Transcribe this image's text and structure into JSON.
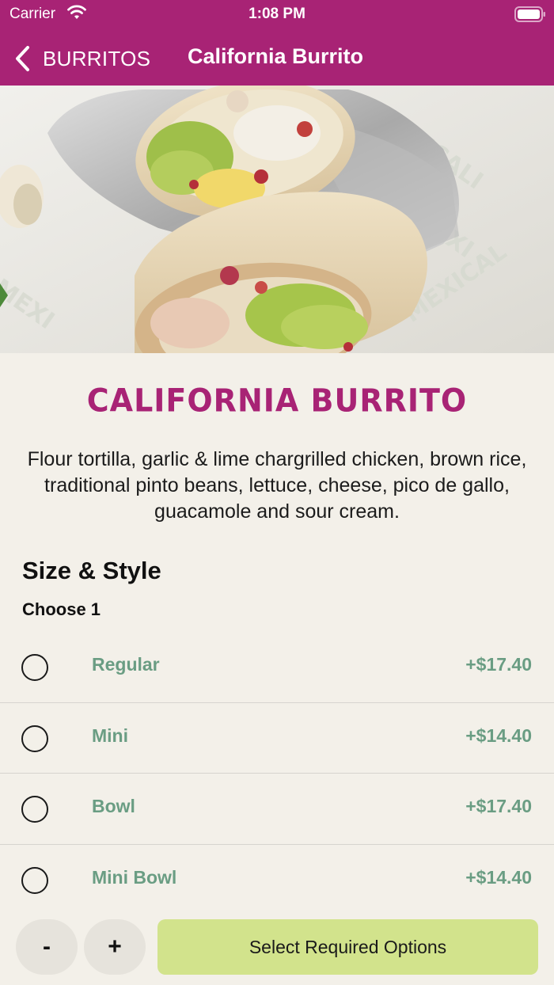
{
  "status_bar": {
    "carrier": "Carrier",
    "time": "1:08 PM"
  },
  "nav": {
    "back_label": "BURRITOS",
    "title": "California Burrito"
  },
  "product": {
    "name": "CALIFORNIA BURRITO",
    "description": "Flour tortilla, garlic & lime chargrilled chicken, brown rice, traditional pinto beans, lettuce, cheese, pico de gallo, guacamole and sour cream."
  },
  "options_group": {
    "title": "Size & Style",
    "subtitle": "Choose 1",
    "items": [
      {
        "label": "Regular",
        "price": "+$17.40"
      },
      {
        "label": "Mini",
        "price": "+$14.40"
      },
      {
        "label": "Bowl",
        "price": "+$17.40"
      },
      {
        "label": "Mini Bowl",
        "price": "+$14.40"
      }
    ]
  },
  "bottom": {
    "minus_label": "-",
    "plus_label": "+",
    "cta_label": "Select Required Options"
  },
  "colors": {
    "brand": "#a82375",
    "option_text": "#6a9d83",
    "cta_bg": "#d2e38c",
    "page_bg": "#f3f0e9"
  },
  "icons": [
    "wifi-icon",
    "battery-icon",
    "chevron-left-icon",
    "radio-unchecked-icon"
  ]
}
